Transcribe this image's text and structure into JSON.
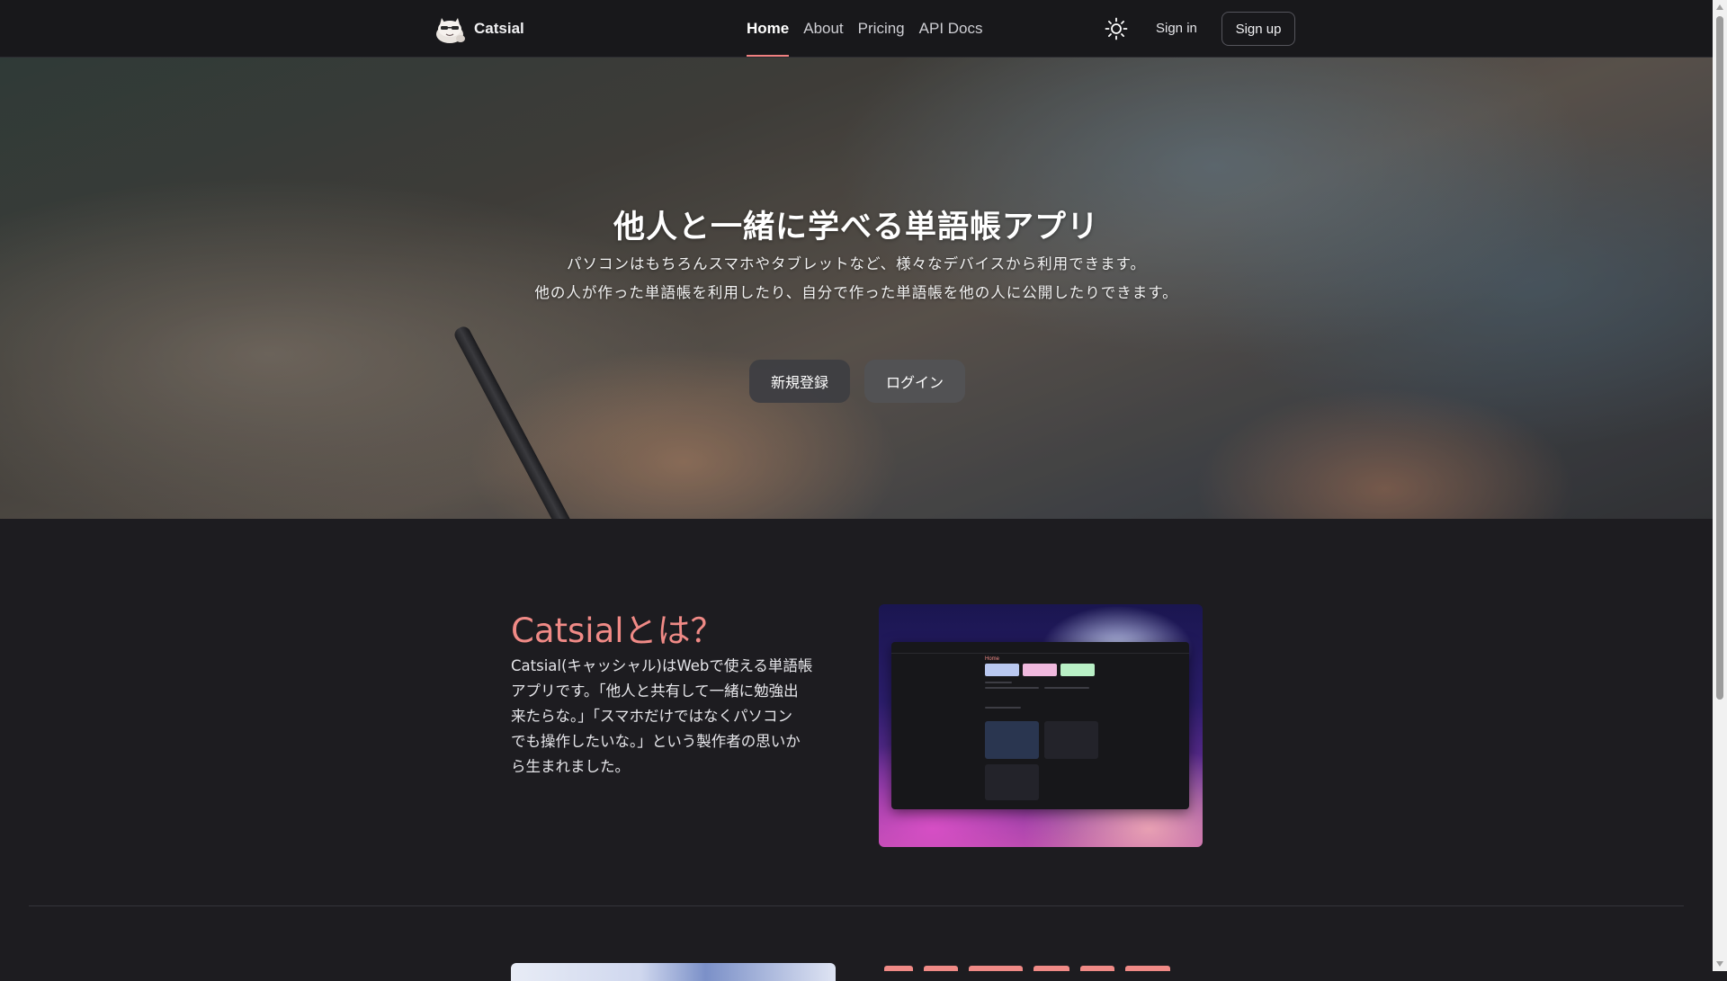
{
  "header": {
    "brand": "Catsial",
    "nav": [
      {
        "label": "Home",
        "active": true
      },
      {
        "label": "About",
        "active": false
      },
      {
        "label": "Pricing",
        "active": false
      },
      {
        "label": "API Docs",
        "active": false
      }
    ],
    "theme_icon": "sun-icon",
    "sign_in": "Sign in",
    "sign_up": "Sign up"
  },
  "hero": {
    "title": "他人と一緒に学べる単語帳アプリ",
    "subtitle_line1": "パソコンはもちろんスマホやタブレットなど、様々なデバイスから利用できます。",
    "subtitle_line2": "他の人が作った単語帳を利用したり、自分で作った単語帳を他の人に公開したりできます。",
    "register_button": "新規登録",
    "login_button": "ログイン"
  },
  "about": {
    "title": "Catsialとは？",
    "text_lines": [
      "Catsial(キャッシャル)はWebで使える単語帳",
      "アプリです。「他人と共有して一緒に勉強出",
      "来たらな。」「スマホだけではなくパソコン",
      "でも操作したいな。」という製作者の思いか",
      "ら生まれました。"
    ],
    "screenshot_label": "Home"
  },
  "colors": {
    "accent": "#f08a86",
    "background": "#1d1c20",
    "header_bg": "#18181b"
  }
}
